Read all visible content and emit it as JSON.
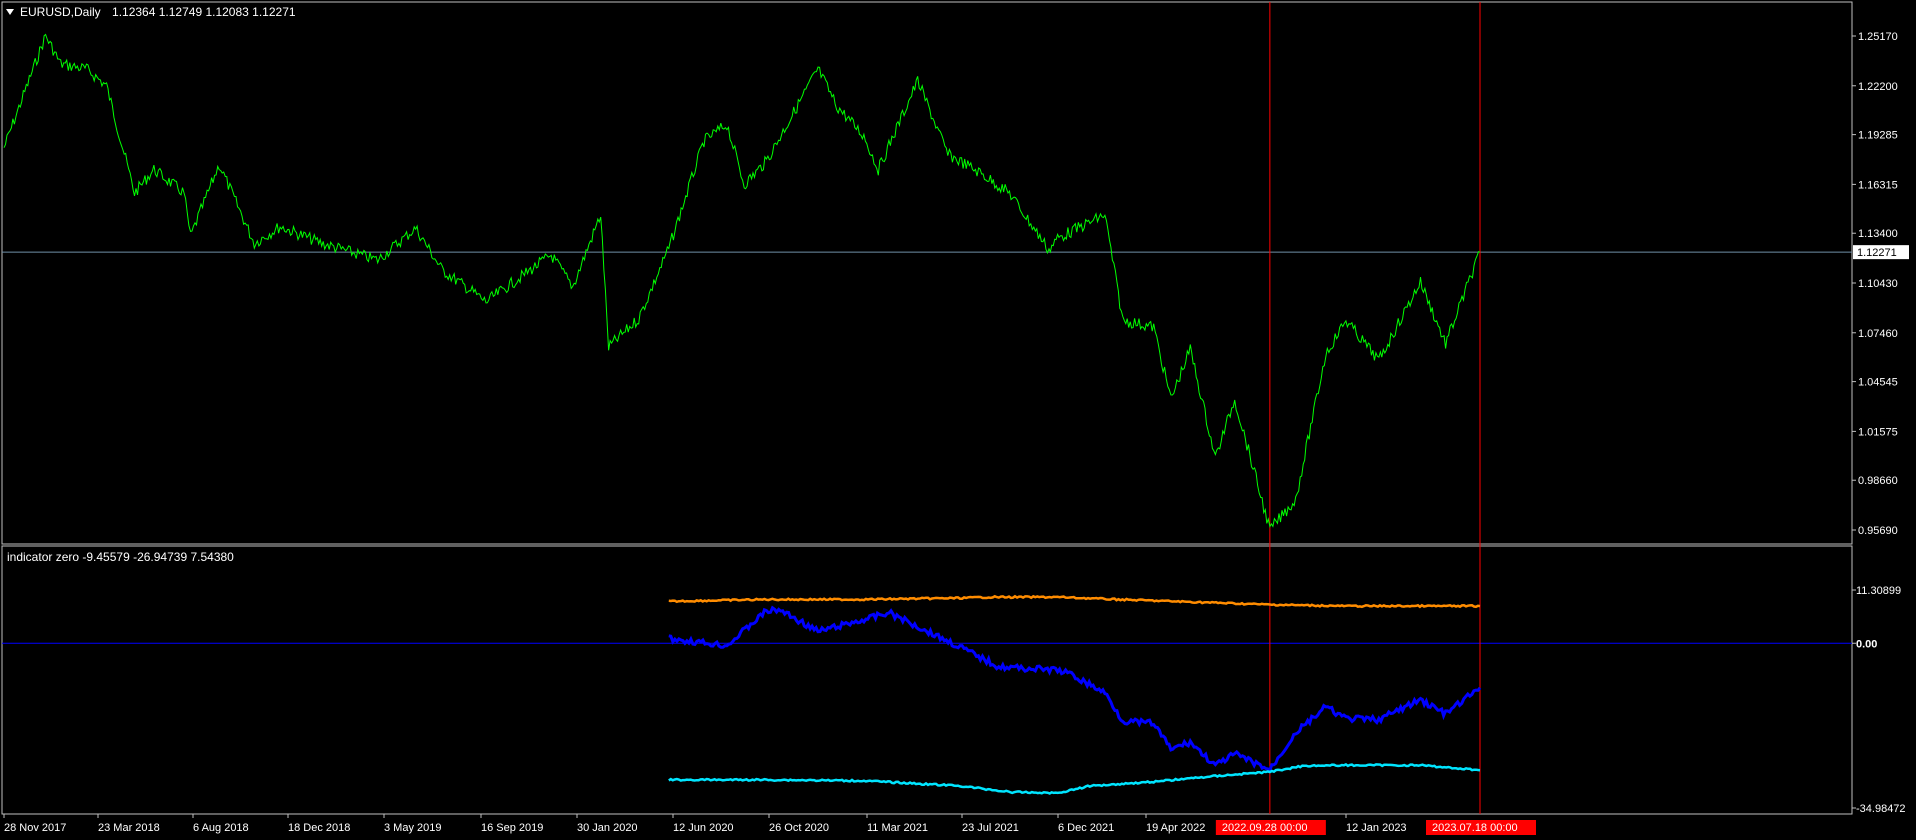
{
  "main": {
    "symbol_label": "EURUSD,Daily",
    "ohlc_label": "1.12364 1.12749 1.12083 1.12271",
    "current_price_label": "1.12271",
    "menu_arrow_icon": "triangle-down-icon"
  },
  "indicator": {
    "label": "indicator zero -9.45579 -26.94739 7.54380"
  },
  "x_axis": {
    "labels": [
      "28 Nov 2017",
      "23 Mar 2018",
      "6 Aug 2018",
      "18 Dec 2018",
      "3 May 2019",
      "16 Sep 2019",
      "30 Jan 2020",
      "12 Jun 2020",
      "26 Oct 2020",
      "11 Mar 2021",
      "23 Jul 2021",
      "6 Dec 2021",
      "19 Apr 2022",
      "12 Jan 2023"
    ],
    "highlight_labels": [
      "2022.09.28 00:00",
      "2023.07.18 00:00"
    ]
  },
  "colors": {
    "price": "#00ff00",
    "orange": "#ff8c00",
    "blue": "#0000ff",
    "cyan": "#00e5ff",
    "marker": "#ff0000",
    "grid_border": "#c0c0c0",
    "price_line": "#6f8fa8"
  },
  "chart_data": [
    {
      "type": "line",
      "title": "EURUSD,Daily",
      "ylim": [
        0.9569,
        1.2517
      ],
      "y_ticks": [
        "1.25170",
        "1.22200",
        "1.19285",
        "1.16315",
        "1.13400",
        "1.10430",
        "1.07460",
        "1.04545",
        "1.01575",
        "0.98660",
        "0.95690"
      ],
      "current_price": 1.12271,
      "series": [
        {
          "x": [
            "2017-11-28",
            "2018-01-25",
            "2018-02-15",
            "2018-03-23",
            "2018-04-20",
            "2018-05-29",
            "2018-06-25",
            "2018-08-06",
            "2018-08-15",
            "2018-09-24",
            "2018-11-12",
            "2018-12-18",
            "2019-02-14",
            "2019-04-01",
            "2019-05-03",
            "2019-06-25",
            "2019-08-01",
            "2019-09-16",
            "2019-10-01",
            "2019-12-31",
            "2020-01-30",
            "2020-03-09",
            "2020-03-20",
            "2020-05-01",
            "2020-06-12",
            "2020-07-31",
            "2020-09-01",
            "2020-09-25",
            "2020-10-26",
            "2021-01-06",
            "2021-02-01",
            "2021-03-11",
            "2021-03-31",
            "2021-05-25",
            "2021-07-06",
            "2021-07-23",
            "2021-08-20",
            "2021-09-30",
            "2021-11-24",
            "2021-12-06",
            "2022-02-10",
            "2022-03-07",
            "2022-04-19",
            "2022-05-13",
            "2022-06-09",
            "2022-07-14",
            "2022-08-10",
            "2022-09-28",
            "2022-11-03",
            "2022-12-15",
            "2023-01-12",
            "2023-02-27",
            "2023-04-26",
            "2023-05-31",
            "2023-07-18"
          ],
          "y": [
            1.185,
            1.252,
            1.235,
            1.232,
            1.222,
            1.158,
            1.172,
            1.158,
            1.132,
            1.175,
            1.128,
            1.138,
            1.128,
            1.122,
            1.118,
            1.137,
            1.112,
            1.098,
            1.093,
            1.121,
            1.102,
            1.145,
            1.066,
            1.083,
            1.125,
            1.189,
            1.199,
            1.163,
            1.177,
            1.232,
            1.21,
            1.192,
            1.172,
            1.225,
            1.181,
            1.177,
            1.17,
            1.158,
            1.124,
            1.131,
            1.145,
            1.082,
            1.078,
            1.035,
            1.065,
            1.0,
            1.035,
            0.957,
            0.975,
            1.062,
            1.082,
            1.058,
            1.105,
            1.068,
            1.1227
          ]
        }
      ]
    },
    {
      "type": "line",
      "title": "indicator zero -9.45579 -26.94739 7.54380",
      "ylim": [
        -34.98472,
        11.30899
      ],
      "y_ticks": [
        "11.30899",
        "0.00",
        "-34.98472"
      ],
      "zero_line": 0,
      "series": [
        {
          "x": [
            "2020-06-12",
            "2020-10-26",
            "2021-03-11",
            "2021-07-23",
            "2021-09-01",
            "2021-12-06",
            "2022-03-01",
            "2022-09-28",
            "2023-01-12",
            "2023-07-18"
          ],
          "y": [
            8.9,
            9.3,
            9.3,
            9.6,
            9.8,
            9.8,
            9.3,
            8.2,
            7.9,
            7.9
          ]
        },
        {
          "x": [
            "2020-06-12",
            "2020-09-01",
            "2020-10-26",
            "2020-11-15",
            "2021-01-06",
            "2021-03-11",
            "2021-04-15",
            "2021-07-23",
            "2021-09-15",
            "2021-12-06",
            "2021-12-20",
            "2022-02-10",
            "2022-03-07",
            "2022-04-19",
            "2022-05-13",
            "2022-06-09",
            "2022-07-14",
            "2022-08-10",
            "2022-09-28",
            "2022-11-03",
            "2022-12-15",
            "2023-01-12",
            "2023-02-27",
            "2023-04-26",
            "2023-05-31",
            "2023-07-18"
          ],
          "y": [
            1.0,
            -0.5,
            6.9,
            7.0,
            2.5,
            5.0,
            6.5,
            -0.8,
            -5.0,
            -5.7,
            -6.3,
            -10.5,
            -16.5,
            -17.0,
            -22.5,
            -21.0,
            -26.0,
            -23.5,
            -26.9,
            -19.0,
            -13.5,
            -16.0,
            -16.2,
            -12.0,
            -15.0,
            -9.46
          ]
        },
        {
          "x": [
            "2020-06-12",
            "2020-10-26",
            "2021-03-11",
            "2021-07-23",
            "2021-10-01",
            "2021-12-06",
            "2022-01-20",
            "2022-04-19",
            "2022-07-14",
            "2022-09-28",
            "2022-11-15",
            "2023-01-12",
            "2023-04-26",
            "2023-07-18"
          ],
          "y": [
            -29.0,
            -29.0,
            -29.2,
            -30.3,
            -31.6,
            -31.8,
            -30.3,
            -29.4,
            -28.2,
            -27.3,
            -26.0,
            -25.9,
            -25.9,
            -26.95
          ]
        }
      ]
    }
  ]
}
